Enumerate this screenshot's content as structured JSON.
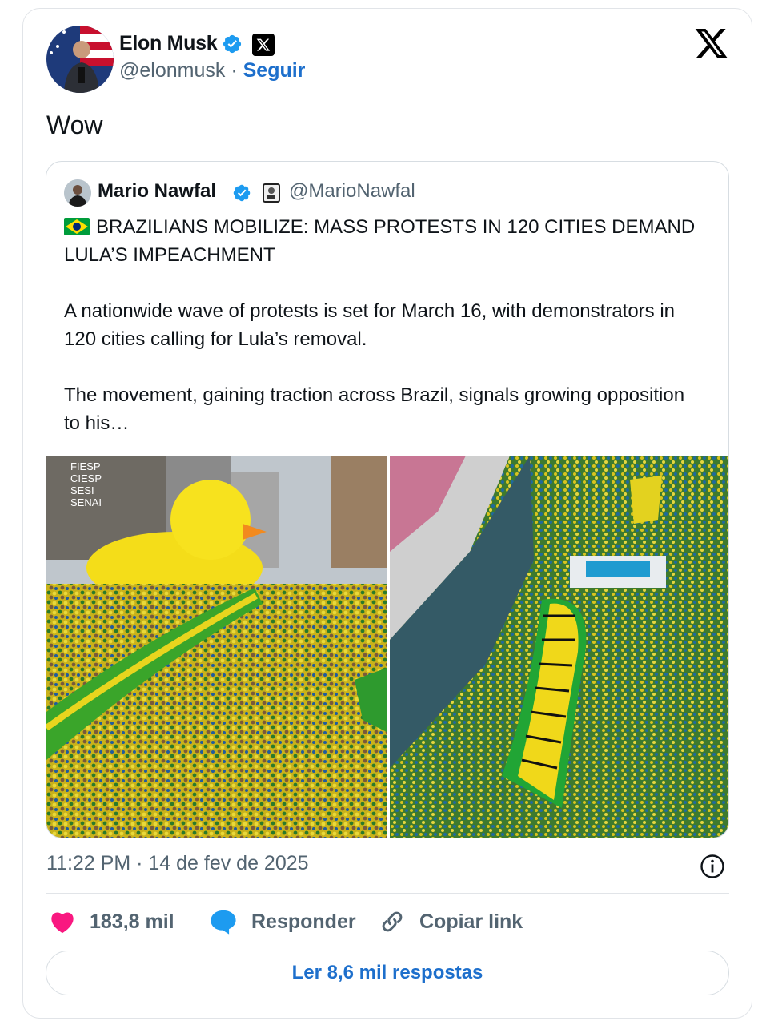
{
  "tweet": {
    "author": {
      "name": "Elon Musk",
      "handle": "@elonmusk",
      "separator": "·",
      "follow_label": "Seguir"
    },
    "text": "Wow",
    "timestamp": "11:22 PM · 14 de fev de 2025"
  },
  "quoted_tweet": {
    "author": {
      "name": "Mario Nawfal",
      "handle": "@MarioNawfal"
    },
    "headline": "BRAZILIANS MOBILIZE: MASS PROTESTS IN 120 CITIES DEMAND LULA’S IMPEACHMENT",
    "paragraph1": "A nationwide wave of protests is set for March 16, with demonstrators in 120 cities calling for Lula’s removal.",
    "paragraph2": "The movement, gaining traction across Brazil, signals growing opposition to his…",
    "photo_left_sign": [
      "FIESP",
      "CIESP",
      "SESI",
      "SENAI"
    ]
  },
  "actions": {
    "likes": "183,8 mil",
    "reply_label": "Responder",
    "copy_link_label": "Copiar link",
    "read_replies_label": "Ler 8,6 mil respostas"
  },
  "colors": {
    "link": "#1d6fcc",
    "verified": "#1d9bf0",
    "like": "#f91880",
    "reply": "#1d9bf0",
    "muted": "#536471"
  },
  "icons": [
    "verified-badge-icon",
    "x-logo-icon",
    "info-icon",
    "heart-icon",
    "reply-bubble-icon",
    "link-icon",
    "brazil-flag-icon"
  ]
}
